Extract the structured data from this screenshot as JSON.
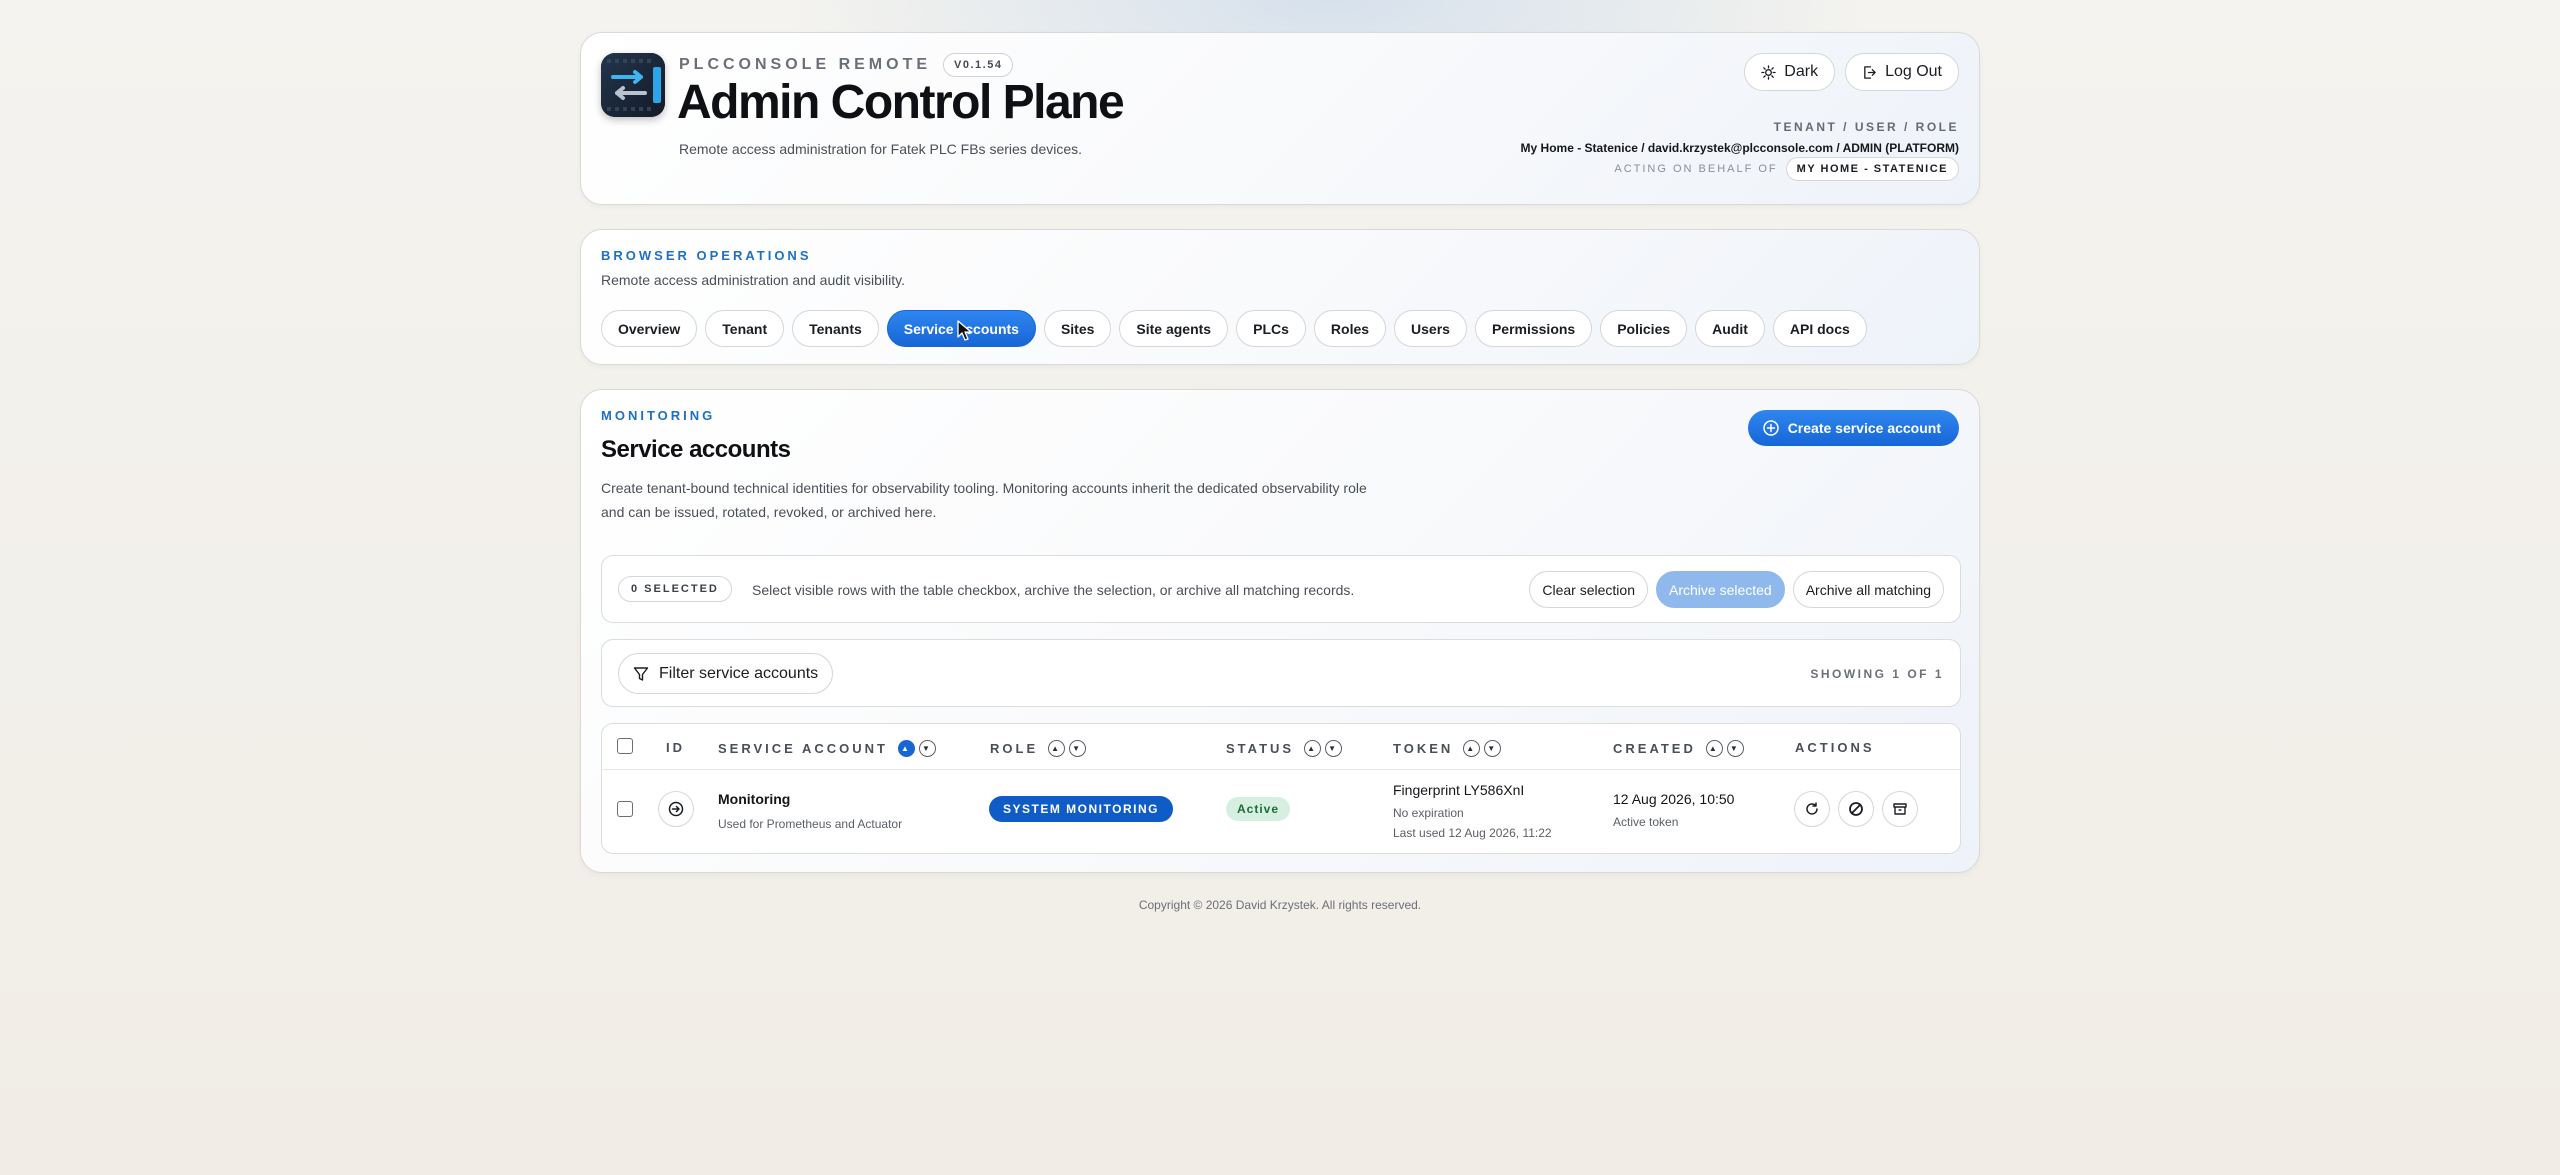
{
  "header": {
    "brand": "PLCCONSOLE REMOTE",
    "version": "V0.1.54",
    "title": "Admin Control Plane",
    "subtitle": "Remote access administration for Fatek PLC FBs series devices.",
    "dark_label": "Dark",
    "logout_label": "Log Out",
    "meta_label": "TENANT / USER / ROLE",
    "meta_user": "My Home - Statenice / david.krzystek@plcconsole.com / ADMIN (PLATFORM)",
    "acting_label": "ACTING ON BEHALF OF",
    "acting_value": "MY HOME - STATENICE"
  },
  "nav": {
    "eyebrow": "BROWSER OPERATIONS",
    "description": "Remote access administration and audit visibility.",
    "tabs": [
      {
        "label": "Overview"
      },
      {
        "label": "Tenant"
      },
      {
        "label": "Tenants"
      },
      {
        "label": "Service accounts",
        "active": true
      },
      {
        "label": "Sites"
      },
      {
        "label": "Site agents"
      },
      {
        "label": "PLCs"
      },
      {
        "label": "Roles"
      },
      {
        "label": "Users"
      },
      {
        "label": "Permissions"
      },
      {
        "label": "Policies"
      },
      {
        "label": "Audit"
      },
      {
        "label": "API docs"
      }
    ]
  },
  "main": {
    "eyebrow": "MONITORING",
    "title": "Service accounts",
    "description": "Create tenant-bound technical identities for observability tooling. Monitoring accounts inherit the dedicated observability role and can be issued, rotated, revoked, or archived here.",
    "create_label": "Create service account",
    "selection": {
      "count": "0 SELECTED",
      "text": "Select visible rows with the table checkbox, archive the selection, or archive all matching records.",
      "clear_label": "Clear selection",
      "archive_selected_label": "Archive selected",
      "archive_all_label": "Archive all matching"
    },
    "filter": {
      "label": "Filter service accounts",
      "showing": "SHOWING 1 OF 1"
    },
    "table": {
      "columns": {
        "id": "ID",
        "account": "SERVICE ACCOUNT",
        "role": "ROLE",
        "status": "STATUS",
        "token": "TOKEN",
        "created": "CREATED",
        "actions": "ACTIONS"
      },
      "rows": [
        {
          "name": "Monitoring",
          "description": "Used for Prometheus and Actuator",
          "role": "SYSTEM MONITORING",
          "status": "Active",
          "token_fingerprint": "Fingerprint LY586XnI",
          "token_expiry": "No expiration",
          "token_last_used": "Last used 12 Aug 2026, 11:22",
          "created": "12 Aug 2026, 10:50",
          "created_sub": "Active token"
        }
      ]
    }
  },
  "footer": "Copyright © 2026 David Krzystek. All rights reserved.",
  "colors": {
    "accent": "#1766d6",
    "status_active_bg": "#d6efe0",
    "status_active_fg": "#1c6d3c"
  }
}
